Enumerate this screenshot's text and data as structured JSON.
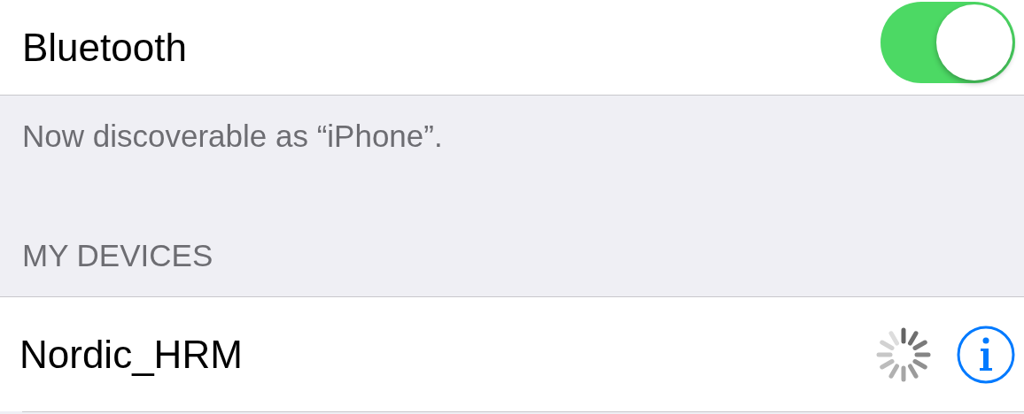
{
  "bluetooth": {
    "label": "Bluetooth",
    "on": true
  },
  "footer": "Now discoverable as “iPhone”.",
  "section_header": "MY DEVICES",
  "devices": [
    {
      "name": "Nordic_HRM",
      "connecting": true
    }
  ]
}
